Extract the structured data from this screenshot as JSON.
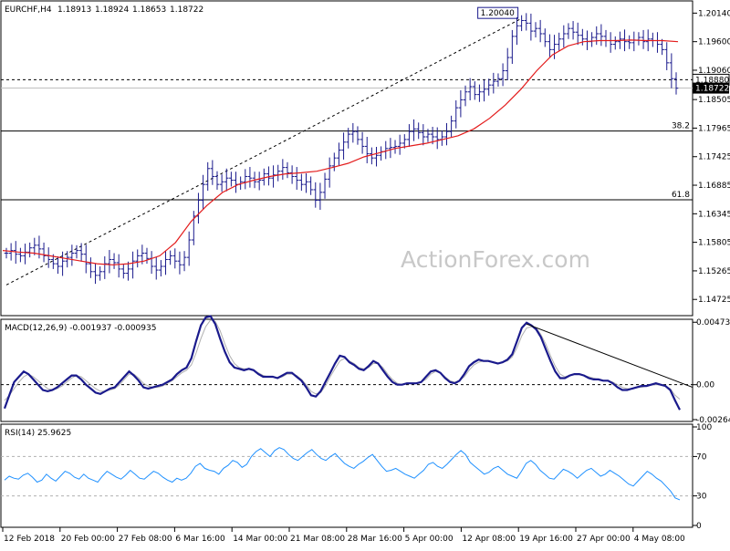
{
  "chart_data": {
    "type": "line",
    "symbol": "EURCHF,H4",
    "ohlc": {
      "open": "1.18913",
      "high": "1.18924",
      "low": "1.18653",
      "close": "1.18722"
    },
    "watermark": "ActionForex.com",
    "x_labels": [
      "12 Feb 2018",
      "20 Feb 00:00",
      "27 Feb 08:00",
      "6 Mar 16:00",
      "14 Mar 00:00",
      "21 Mar 08:00",
      "28 Mar 16:00",
      "5 Apr 00:00",
      "12 Apr 08:00",
      "19 Apr 16:00",
      "27 Apr 00:00",
      "4 May 08:00"
    ],
    "price_panel": {
      "ylim": [
        1.1447,
        1.2025
      ],
      "y_ticks": [
        "1.20140",
        "1.19600",
        "1.19060",
        "1.18505",
        "1.17965",
        "1.17425",
        "1.16885",
        "1.16345",
        "1.15805",
        "1.15265",
        "1.14725"
      ],
      "current_price_label": "1.18722",
      "current_price": 1.18722,
      "ref_line_label": "1.18880",
      "ref_line": 1.1888,
      "peak_label": "1.20040",
      "peak_value": 1.2004,
      "fib_levels": [
        {
          "label": "38.2",
          "value": 1.1791
        },
        {
          "label": "61.8",
          "value": 1.1661
        }
      ],
      "close": [
        1.156,
        1.1565,
        1.1558,
        1.1555,
        1.1562,
        1.157,
        1.1575,
        1.1568,
        1.1555,
        1.1548,
        1.154,
        1.1535,
        1.1545,
        1.1552,
        1.156,
        1.1565,
        1.1558,
        1.154,
        1.1525,
        1.1518,
        1.1525,
        1.154,
        1.1548,
        1.1542,
        1.153,
        1.1522,
        1.153,
        1.1545,
        1.1555,
        1.156,
        1.155,
        1.1535,
        1.1528,
        1.1535,
        1.1548,
        1.1555,
        1.1545,
        1.1538,
        1.1552,
        1.1585,
        1.163,
        1.166,
        1.169,
        1.172,
        1.1705,
        1.169,
        1.1695,
        1.1702,
        1.1698,
        1.169,
        1.1695,
        1.1705,
        1.1702,
        1.1695,
        1.1698,
        1.171,
        1.1702,
        1.1708,
        1.1715,
        1.1722,
        1.1712,
        1.1705,
        1.1698,
        1.169,
        1.1695,
        1.168,
        1.166,
        1.1675,
        1.17,
        1.1725,
        1.174,
        1.1755,
        1.177,
        1.1785,
        1.179,
        1.1775,
        1.1762,
        1.1748,
        1.174,
        1.1745,
        1.1752,
        1.1758,
        1.176,
        1.1762,
        1.1768,
        1.1775,
        1.179,
        1.1795,
        1.1788,
        1.178,
        1.1785,
        1.178,
        1.1775,
        1.178,
        1.179,
        1.181,
        1.1835,
        1.185,
        1.1865,
        1.1875,
        1.186,
        1.1865,
        1.187,
        1.1878,
        1.1885,
        1.189,
        1.1905,
        1.193,
        1.197,
        1.199,
        1.2,
        1.1995,
        1.198,
        1.1985,
        1.1975,
        1.196,
        1.1945,
        1.1955,
        1.1965,
        1.1975,
        1.1985,
        1.1978,
        1.1972,
        1.1965,
        1.196,
        1.1968,
        1.1975,
        1.197,
        1.1962,
        1.1955,
        1.196,
        1.1965,
        1.196,
        1.1958,
        1.1963,
        1.1968,
        1.196,
        1.1965,
        1.1962,
        1.1955,
        1.1945,
        1.192,
        1.189,
        1.1872
      ],
      "ma_label": "moving average (red)",
      "ma_values": [
        1.1565,
        1.1562,
        1.156,
        1.1555,
        1.155,
        1.1545,
        1.154,
        1.1538,
        1.154,
        1.1545,
        1.1555,
        1.158,
        1.162,
        1.165,
        1.1675,
        1.169,
        1.1698,
        1.1705,
        1.171,
        1.1712,
        1.1715,
        1.1722,
        1.173,
        1.1742,
        1.175,
        1.1758,
        1.1763,
        1.1768,
        1.1775,
        1.1782,
        1.1795,
        1.1815,
        1.184,
        1.187,
        1.1905,
        1.1935,
        1.1952,
        1.196,
        1.1962,
        1.1962,
        1.1963,
        1.1962,
        1.1962,
        1.196
      ]
    },
    "macd_panel": {
      "label": "MACD(12,26,9) -0.001937 -0.000935",
      "ylim": [
        -0.00265,
        0.00475
      ],
      "y_ticks": [
        {
          "label": "0.004733",
          "value": 0.004733
        },
        {
          "label": "0.00",
          "value": 0.0
        },
        {
          "label": "-0.002648",
          "value": -0.002648
        }
      ],
      "macd": [
        -0.0018,
        -0.0008,
        0.0002,
        0.0006,
        0.001,
        0.0008,
        0.0004,
        0.0,
        -0.0004,
        -0.0005,
        -0.0004,
        -0.0002,
        0.0001,
        0.0004,
        0.0007,
        0.0007,
        0.0004,
        0.0,
        -0.0003,
        -0.0006,
        -0.0007,
        -0.0005,
        -0.0003,
        -0.0002,
        0.0002,
        0.0006,
        0.001,
        0.0007,
        0.0003,
        -0.0002,
        -0.0003,
        -0.0002,
        -0.0001,
        0.0,
        0.0002,
        0.0004,
        0.0008,
        0.0011,
        0.0013,
        0.002,
        0.0033,
        0.0045,
        0.0051,
        0.0052,
        0.0046,
        0.0035,
        0.0025,
        0.0017,
        0.0013,
        0.0012,
        0.0011,
        0.0012,
        0.0011,
        0.0008,
        0.0006,
        0.0006,
        0.0006,
        0.0005,
        0.0007,
        0.0009,
        0.0009,
        0.0006,
        0.0003,
        -0.0002,
        -0.0008,
        -0.0009,
        -0.0005,
        0.0002,
        0.0009,
        0.0016,
        0.0022,
        0.0021,
        0.0017,
        0.0015,
        0.0012,
        0.0011,
        0.0014,
        0.0018,
        0.0016,
        0.0011,
        0.0006,
        0.0002,
        0.0,
        0.0,
        0.0001,
        0.0001,
        0.0001,
        0.0002,
        0.0006,
        0.001,
        0.0011,
        0.0009,
        0.0005,
        0.0002,
        0.0001,
        0.0003,
        0.0008,
        0.0014,
        0.0017,
        0.0019,
        0.0018,
        0.0018,
        0.0017,
        0.0016,
        0.0017,
        0.0019,
        0.0023,
        0.0033,
        0.0043,
        0.0047,
        0.0045,
        0.0042,
        0.0036,
        0.0027,
        0.0018,
        0.001,
        0.0005,
        0.0005,
        0.0007,
        0.0008,
        0.0008,
        0.0007,
        0.0005,
        0.0004,
        0.0004,
        0.0003,
        0.0003,
        0.0001,
        -0.0002,
        -0.0004,
        -0.0004,
        -0.0003,
        -0.0002,
        -0.0001,
        -0.0001,
        0.0,
        0.0001,
        0.0,
        -0.0001,
        -0.0004,
        -0.0012,
        -0.0019
      ],
      "signal": [
        -0.0012,
        -0.0008,
        -0.0003,
        0.0002,
        0.0006,
        0.0008,
        0.0006,
        0.0003,
        0.0,
        -0.0003,
        -0.0004,
        -0.0003,
        -0.0001,
        0.0002,
        0.0005,
        0.0007,
        0.0006,
        0.0003,
        0.0,
        -0.0003,
        -0.0005,
        -0.0005,
        -0.0004,
        -0.0003,
        0.0,
        0.0004,
        0.0008,
        0.0008,
        0.0005,
        0.0001,
        -0.0001,
        -0.0002,
        -0.0002,
        -0.0001,
        0.0001,
        0.0003,
        0.0006,
        0.0009,
        0.0011,
        0.0015,
        0.0024,
        0.0035,
        0.0044,
        0.0049,
        0.0048,
        0.0041,
        0.0031,
        0.0022,
        0.0016,
        0.0013,
        0.0012,
        0.0012,
        0.0011,
        0.0009,
        0.0007,
        0.0006,
        0.0006,
        0.0005,
        0.0006,
        0.0008,
        0.0008,
        0.0007,
        0.0004,
        0.0,
        -0.0005,
        -0.0007,
        -0.0006,
        -0.0001,
        0.0006,
        0.0012,
        0.0018,
        0.002,
        0.0018,
        0.0016,
        0.0013,
        0.0012,
        0.0013,
        0.0016,
        0.0016,
        0.0013,
        0.0008,
        0.0004,
        0.0001,
        0.0,
        0.0001,
        0.0001,
        0.0001,
        0.0002,
        0.0004,
        0.0008,
        0.001,
        0.0009,
        0.0006,
        0.0003,
        0.0002,
        0.0003,
        0.0006,
        0.0011,
        0.0015,
        0.0017,
        0.0018,
        0.0018,
        0.0017,
        0.0016,
        0.0017,
        0.0018,
        0.0021,
        0.0028,
        0.0037,
        0.0043,
        0.0044,
        0.0043,
        0.0038,
        0.0031,
        0.0022,
        0.0014,
        0.0008,
        0.0006,
        0.0007,
        0.0008,
        0.0008,
        0.0007,
        0.0006,
        0.0005,
        0.0004,
        0.0003,
        0.0003,
        0.0002,
        0.0,
        -0.0002,
        -0.0003,
        -0.0003,
        -0.0002,
        -0.0002,
        -0.0001,
        0.0,
        0.0,
        0.0,
        -0.0001,
        -0.0003,
        -0.0008,
        -0.0011
      ],
      "trendline": {
        "from": 0.0046,
        "to": -0.0002
      }
    },
    "rsi_panel": {
      "label": "RSI(14) 25.9625",
      "ylim": [
        0,
        100
      ],
      "y_ticks": [
        {
          "label": "100",
          "value": 100
        },
        {
          "label": "70",
          "value": 70
        },
        {
          "label": "30",
          "value": 30
        },
        {
          "label": "0",
          "value": 0
        }
      ],
      "levels": [
        70,
        30
      ],
      "values": [
        46,
        50,
        48,
        47,
        51,
        53,
        49,
        44,
        46,
        52,
        48,
        45,
        50,
        55,
        53,
        49,
        47,
        52,
        48,
        46,
        44,
        50,
        55,
        52,
        49,
        47,
        51,
        56,
        52,
        48,
        47,
        51,
        55,
        53,
        49,
        46,
        44,
        48,
        46,
        48,
        53,
        60,
        63,
        58,
        56,
        55,
        52,
        58,
        61,
        66,
        64,
        59,
        62,
        70,
        75,
        78,
        74,
        70,
        76,
        79,
        77,
        72,
        68,
        66,
        70,
        74,
        77,
        72,
        68,
        66,
        70,
        73,
        68,
        63,
        60,
        58,
        62,
        65,
        69,
        72,
        66,
        60,
        55,
        56,
        58,
        55,
        52,
        50,
        48,
        52,
        56,
        62,
        64,
        60,
        58,
        62,
        67,
        72,
        76,
        72,
        64,
        60,
        56,
        52,
        54,
        58,
        60,
        56,
        52,
        50,
        48,
        55,
        63,
        66,
        62,
        56,
        52,
        48,
        47,
        52,
        57,
        55,
        52,
        48,
        52,
        56,
        58,
        54,
        50,
        52,
        56,
        53,
        50,
        46,
        42,
        40,
        45,
        50,
        55,
        52,
        48,
        45,
        40,
        35,
        28,
        26
      ]
    }
  }
}
